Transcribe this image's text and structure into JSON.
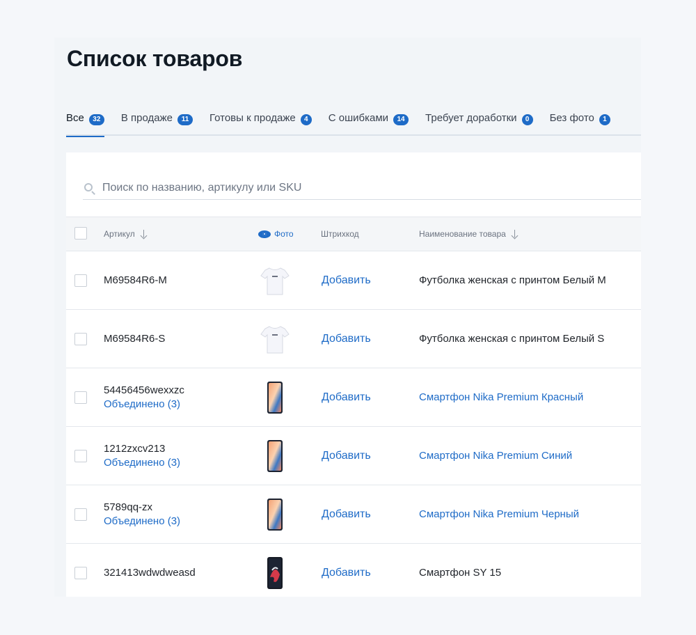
{
  "page": {
    "title": "Список товаров"
  },
  "tabs": [
    {
      "label": "Все",
      "count": "32"
    },
    {
      "label": "В продаже",
      "count": "11"
    },
    {
      "label": "Готовы к продаже",
      "count": "4"
    },
    {
      "label": "С ошибками",
      "count": "14"
    },
    {
      "label": "Требует доработки",
      "count": "0"
    },
    {
      "label": "Без фото",
      "count": "1"
    }
  ],
  "search": {
    "placeholder": "Поиск по названию, артикулу или SKU"
  },
  "table": {
    "columns": {
      "article": "Артикул",
      "photo": "Фото",
      "barcode": "Штрихкод",
      "name": "Наименование товара"
    },
    "rows": [
      {
        "sku": "M69584R6-M",
        "merged": "",
        "photo": "tshirt-photo",
        "barcode_action": "Добавить",
        "name": "Футболка женская с принтом Белый M"
      },
      {
        "sku": "M69584R6-S",
        "merged": "",
        "photo": "tshirt-photo",
        "barcode_action": "Добавить",
        "name": "Футболка женская с принтом Белый S"
      },
      {
        "sku": "54456456wexxzc",
        "merged": "Объединено (3)",
        "photo": "smartphone-photo",
        "barcode_action": "Добавить",
        "name": "Смартфон Nika Premium Красный"
      },
      {
        "sku": "1212zxcv213",
        "merged": "Объединено (3)",
        "photo": "smartphone-photo",
        "barcode_action": "Добавить",
        "name": "Смартфон Nika Premium Синий"
      },
      {
        "sku": "5789qq-zx",
        "merged": "Объединено (3)",
        "photo": "smartphone-photo",
        "barcode_action": "Добавить",
        "name": "Смартфон Nika Premium Черный"
      },
      {
        "sku": "321413wdwdweasd",
        "merged": "",
        "photo": "smartphone-dark-photo",
        "barcode_action": "Добавить",
        "name": "Смартфон SY 15"
      }
    ]
  },
  "colors": {
    "accent": "#1e6bc7",
    "text": "#1f2329",
    "muted": "#6b7380"
  }
}
